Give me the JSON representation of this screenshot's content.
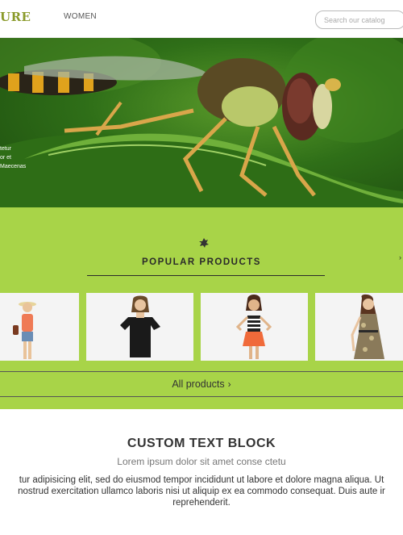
{
  "header": {
    "logo_text": "URE",
    "nav": {
      "women": "WOMEN"
    },
    "search": {
      "placeholder": "Search our catalog"
    }
  },
  "hero": {
    "caption_lines": [
      "tetur",
      "or et",
      "Maecenas"
    ]
  },
  "popular": {
    "title": "POPULAR PRODUCTS",
    "all_products_label": "All products",
    "product_icons": [
      "woman-hat-orange-top-icon",
      "woman-black-top-icon",
      "woman-striped-top-orange-skirt-icon",
      "woman-floral-dress-icon"
    ]
  },
  "custom_text": {
    "title": "CUSTOM TEXT BLOCK",
    "subtitle": "Lorem ipsum dolor sit amet conse ctetu",
    "body_lines": [
      "tur adipisicing elit, sed do eiusmod tempor incididunt ut labore et dolore magna aliqua. Ut",
      "nostrud exercitation ullamco laboris nisi ut aliquip ex ea commodo consequat. Duis aute ir",
      "reprehenderit."
    ]
  },
  "colors": {
    "accent_green": "#a8d448",
    "logo_olive": "#8a9a2a"
  }
}
